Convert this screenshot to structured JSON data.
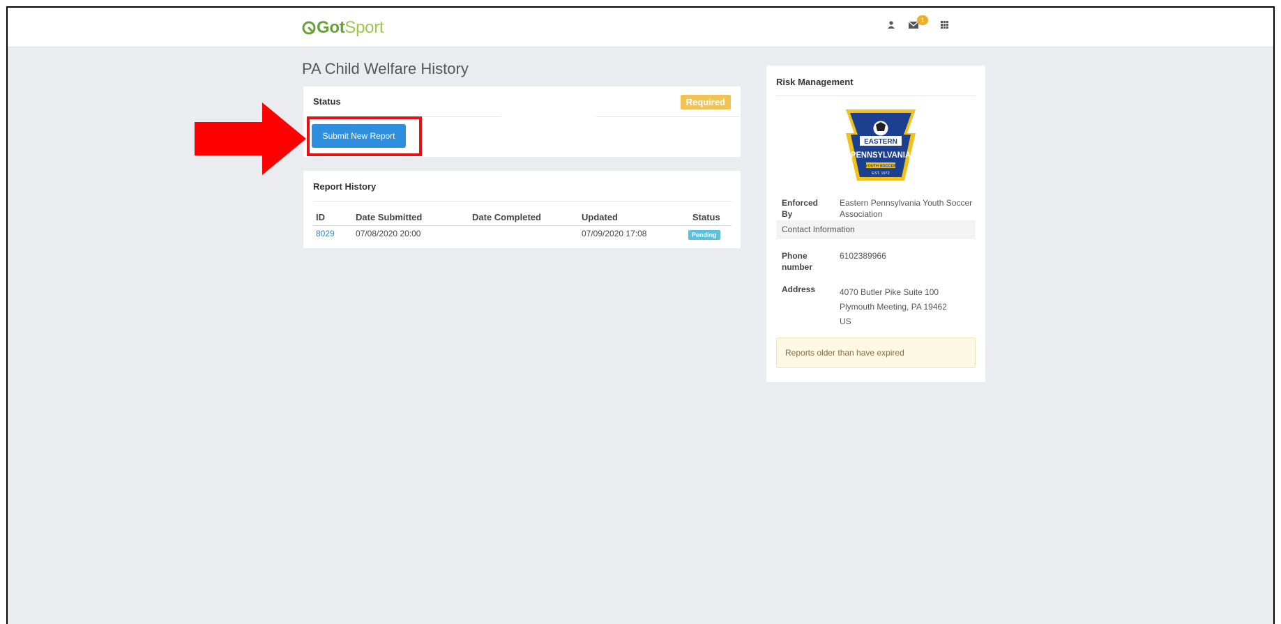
{
  "header": {
    "logo_prefix": "Got",
    "logo_suffix": "Sport",
    "mail_count": "1",
    "user_icon": "user-icon",
    "mail_icon": "envelope-icon",
    "apps_icon": "grid-icon"
  },
  "page": {
    "title": "PA Child Welfare History"
  },
  "status_panel": {
    "heading": "Status",
    "badge": "Required",
    "submit_label": "Submit New Report"
  },
  "report_history": {
    "heading": "Report History",
    "columns": [
      "ID",
      "Date Submitted",
      "Date Completed",
      "Updated",
      "Status"
    ],
    "rows": [
      {
        "id": "8029",
        "date_submitted": "07/08/2020 20:00",
        "date_completed": "",
        "updated": "07/09/2020 17:08",
        "status": "Pending"
      }
    ]
  },
  "risk_management": {
    "heading": "Risk Management",
    "logo_text_1": "EASTERN",
    "logo_text_2": "PENNSYLVANIA",
    "logo_text_3": "YOUTH SOCCER",
    "logo_text_4": "EST. 1972",
    "enforced_label_1": "Enforced",
    "enforced_label_2": "By",
    "enforced_value_1": "Eastern Pennsylvania Youth Soccer",
    "enforced_value_2": "Association",
    "contact_heading": "Contact Information",
    "phone_label_1": "Phone",
    "phone_label_2": "number",
    "phone_value": "6102389966",
    "address_label": "Address",
    "address_line1": "4070 Butler Pike Suite 100",
    "address_line2": "Plymouth Meeting, PA 19462",
    "address_line3": "US",
    "notice": "Reports older than have expired"
  },
  "colors": {
    "brand_green": "#6aa03a",
    "primary_button": "#2d8fdd",
    "required_badge": "#f2c353",
    "pending_badge": "#5bc0de",
    "annotation_red": "#e21212"
  }
}
